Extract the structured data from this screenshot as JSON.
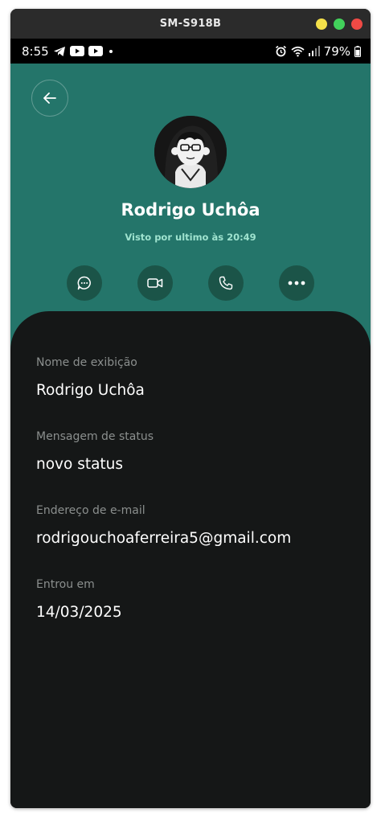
{
  "window": {
    "title": "SM-S918B",
    "controls": [
      {
        "name": "minimize",
        "color": "#f4e04a"
      },
      {
        "name": "maximize",
        "color": "#42d15b"
      },
      {
        "name": "close",
        "color": "#ef4a45"
      }
    ]
  },
  "status_bar": {
    "time": "8:55",
    "left_icons": [
      "telegram-icon",
      "youtube-icon",
      "youtube-icon",
      "dot"
    ],
    "right_icons": [
      "alarm-icon",
      "wifi-icon",
      "signal-icon"
    ],
    "battery": "79%"
  },
  "profile": {
    "name": "Rodrigo Uchôa",
    "last_seen": "Visto por ultimo às 20:49",
    "avatar": "avatar-image",
    "actions": [
      "message-icon",
      "video-icon",
      "phone-icon",
      "more-icon"
    ]
  },
  "details": [
    {
      "label": "Nome de exibição",
      "value": "Rodrigo Uchôa"
    },
    {
      "label": "Mensagem de status",
      "value": "novo status"
    },
    {
      "label": "Endereço de e-mail",
      "value": "rodrigouchoaferreira5@gmail.com"
    },
    {
      "label": "Entrou em",
      "value": "14/03/2025"
    }
  ],
  "colors": {
    "header": "#24756a",
    "panel": "#151717",
    "action_button": "#1b5448",
    "last_seen": "#9fe3cf"
  }
}
